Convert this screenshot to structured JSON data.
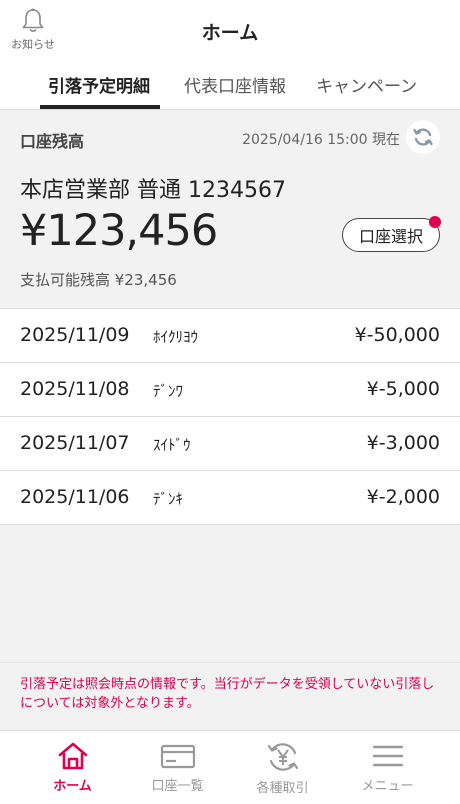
{
  "header": {
    "title": "ホーム",
    "notice_label": "お知らせ"
  },
  "tabs": [
    {
      "label": "引落予定明細",
      "active": true
    },
    {
      "label": "代表口座情報",
      "active": false
    },
    {
      "label": "キャンペーン",
      "active": false
    }
  ],
  "balance": {
    "label": "口座残高",
    "as_of": "2025/04/16 15:00 現在",
    "account": "本店営業部 普通 1234567",
    "amount": "¥123,456",
    "select_label": "口座選択",
    "available": "支払可能残高 ¥23,456"
  },
  "transactions": [
    {
      "date": "2025/11/09",
      "desc": "ﾎｲｸﾘﾖｳ",
      "amount": "¥-50,000"
    },
    {
      "date": "2025/11/08",
      "desc": "ﾃﾞﾝﾜ",
      "amount": "¥-5,000"
    },
    {
      "date": "2025/11/07",
      "desc": "ｽｲﾄﾞｳ",
      "amount": "¥-3,000"
    },
    {
      "date": "2025/11/06",
      "desc": "ﾃﾞﾝｷ",
      "amount": "¥-2,000"
    }
  ],
  "disclaimer": "引落予定は照会時点の情報です。当行がデータを受領していない引落しについては対象外となります。",
  "nav": [
    {
      "label": "ホーム",
      "icon": "home-icon",
      "active": true
    },
    {
      "label": "口座一覧",
      "icon": "card-icon",
      "active": false
    },
    {
      "label": "各種取引",
      "icon": "yen-exchange-icon",
      "active": false
    },
    {
      "label": "メニュー",
      "icon": "menu-icon",
      "active": false
    }
  ],
  "colors": {
    "accent": "#e0004a",
    "text": "#222222",
    "muted": "#999999",
    "background": "#f2f2f2"
  }
}
